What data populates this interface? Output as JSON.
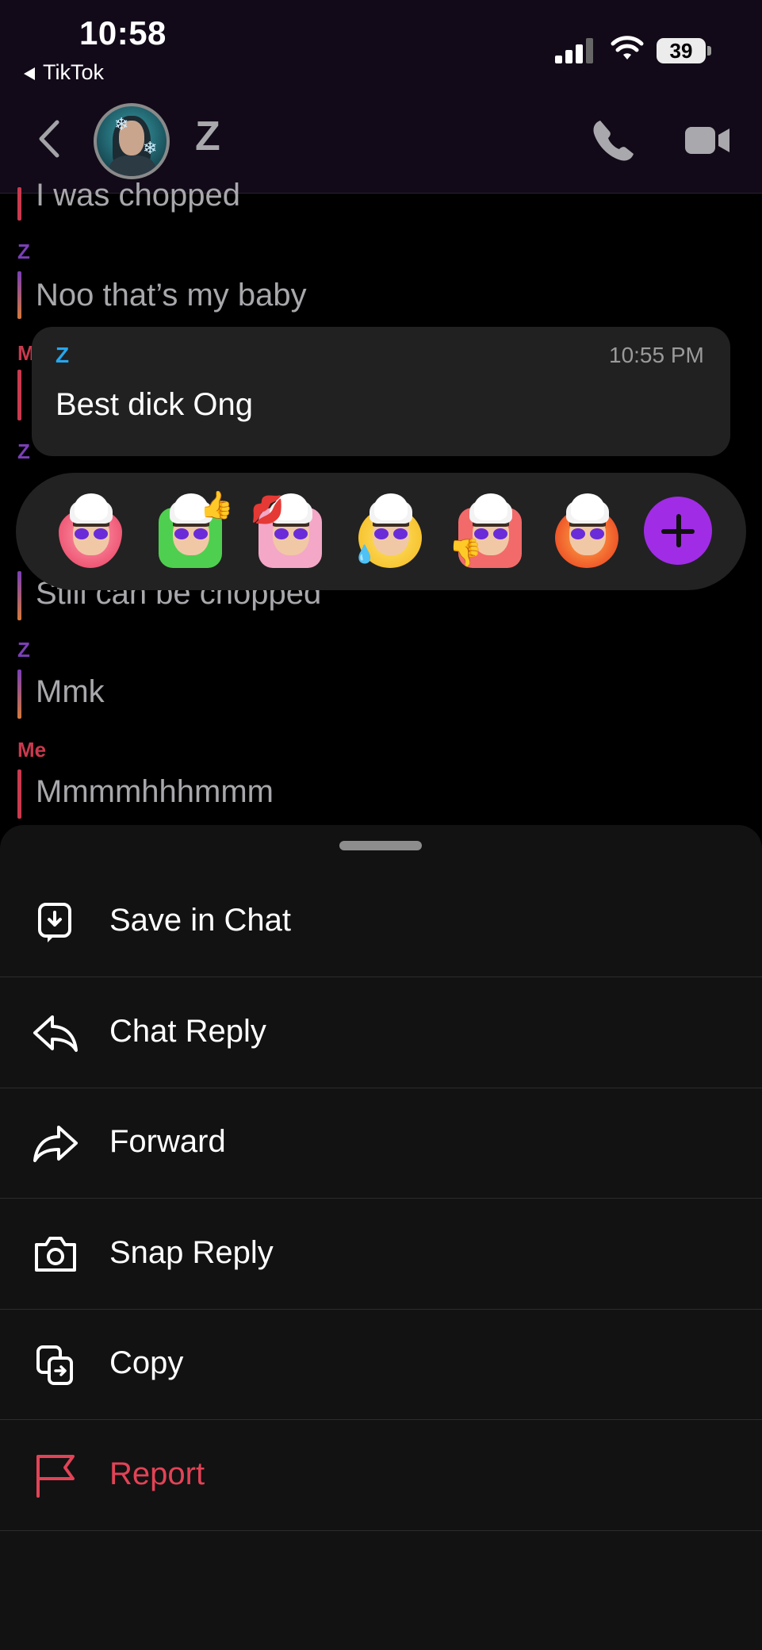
{
  "status_bar": {
    "time": "10:58",
    "back_app": "TikTok",
    "battery": "39"
  },
  "header": {
    "contact_name": "Z"
  },
  "messages": [
    {
      "sender": "",
      "text": "I was chopped",
      "color": "#c93a4e"
    },
    {
      "sender": "Z",
      "text": "Noo that’s my baby",
      "color": "#7b3fb6"
    },
    {
      "sender": "M",
      "text": "",
      "color": "#c93a4e"
    },
    {
      "sender": "Z",
      "text": "",
      "color": "#7b3fb6"
    },
    {
      "sender": "",
      "text": "Still can be chopped",
      "color": "#7b3fb6"
    },
    {
      "sender": "Z",
      "text": "Mmk",
      "color": "#7b3fb6"
    },
    {
      "sender": "Me",
      "text": "Mmmmhhhmmm",
      "color": "#c93a4e"
    }
  ],
  "focused_message": {
    "sender": "Z",
    "time": "10:55 PM",
    "text": "Best dick Ong"
  },
  "reactions": [
    {
      "name": "heart-reaction"
    },
    {
      "name": "thumbs-up-reaction"
    },
    {
      "name": "kiss-reaction"
    },
    {
      "name": "laugh-cry-reaction"
    },
    {
      "name": "thumbs-down-reaction"
    },
    {
      "name": "fire-reaction"
    }
  ],
  "actions": [
    {
      "label": "Save in Chat",
      "icon": "save-icon"
    },
    {
      "label": "Chat Reply",
      "icon": "reply-icon"
    },
    {
      "label": "Forward",
      "icon": "forward-icon"
    },
    {
      "label": "Snap Reply",
      "icon": "camera-icon"
    },
    {
      "label": "Copy",
      "icon": "copy-icon"
    },
    {
      "label": "Report",
      "icon": "flag-icon"
    }
  ],
  "colors": {
    "accent_blue": "#26a6ee",
    "report_red": "#e24356",
    "plus_purple": "#a12ce6"
  }
}
